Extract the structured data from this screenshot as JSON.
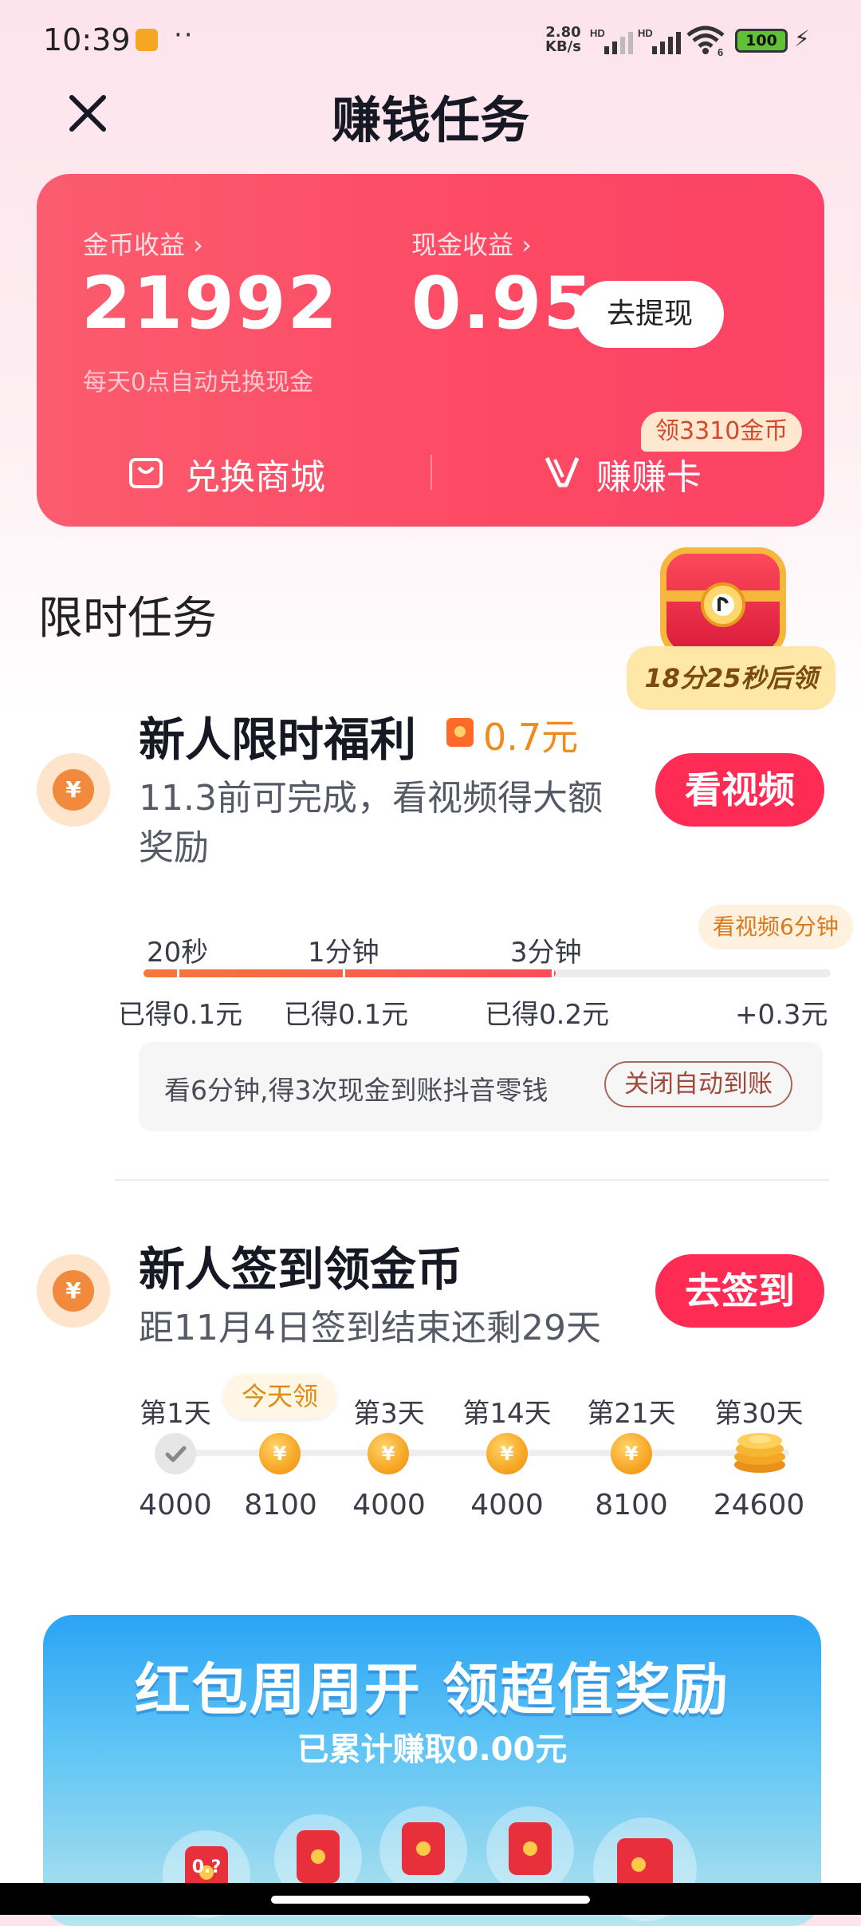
{
  "status_bar": {
    "time": "10:39",
    "dots": "··",
    "net_speed_value": "2.80",
    "net_speed_unit": "KB/s",
    "sim1_label": "HD",
    "sim2_label": "HD",
    "wifi_label": "6",
    "battery": "100"
  },
  "header": {
    "title": "赚钱任务",
    "close_icon": "close-icon"
  },
  "earnings": {
    "coin_label": "金币收益 ›",
    "coin_value": "21992",
    "coin_note": "每天0点自动兑换现金",
    "cash_label": "现金收益 ›",
    "cash_value": "0.95",
    "withdraw_label": "去提现",
    "store_label": "兑换商城",
    "card_label": "赚赚卡",
    "promo_chip": "领3310金币"
  },
  "limited": {
    "section_title": "限时任务",
    "chest_timer": "18分25秒后领",
    "task": {
      "title": "新人限时福利",
      "reward": "0.7元",
      "desc_line1": "11.3前可完成，看视频得大额",
      "desc_line2": "奖励",
      "cta": "看视频",
      "milestones": [
        {
          "time": "20秒",
          "amount": "已得0.1元"
        },
        {
          "time": "1分钟",
          "amount": "已得0.1元"
        },
        {
          "time": "3分钟",
          "amount": "已得0.2元"
        },
        {
          "time": "看视频6分钟",
          "amount": "+0.3元"
        }
      ],
      "progress": 0.6,
      "info_text": "看6分钟,得3次现金到账抖音零钱",
      "auto_button": "关闭自动到账"
    }
  },
  "checkin": {
    "title": "新人签到领金币",
    "desc": "距11月4日签到结束还剩29天",
    "cta": "去签到",
    "today_tag": "今天领",
    "days": [
      {
        "label": "第1天",
        "amount": "4000",
        "state": "done"
      },
      {
        "label": "",
        "amount": "8100",
        "state": "today"
      },
      {
        "label": "第3天",
        "amount": "4000",
        "state": "coin"
      },
      {
        "label": "第14天",
        "amount": "4000",
        "state": "coin"
      },
      {
        "label": "第21天",
        "amount": "8100",
        "state": "coin"
      },
      {
        "label": "第30天",
        "amount": "24600",
        "state": "pile"
      }
    ],
    "coin_symbol": "¥"
  },
  "banner": {
    "title": "红包周周开 领超值奖励",
    "subtitle": "已累计赚取0.00元",
    "first_bubble_label": "0.?"
  },
  "colors": {
    "accent": "#fe2c55",
    "card": "#fb5469",
    "coin": "#f7a625"
  }
}
